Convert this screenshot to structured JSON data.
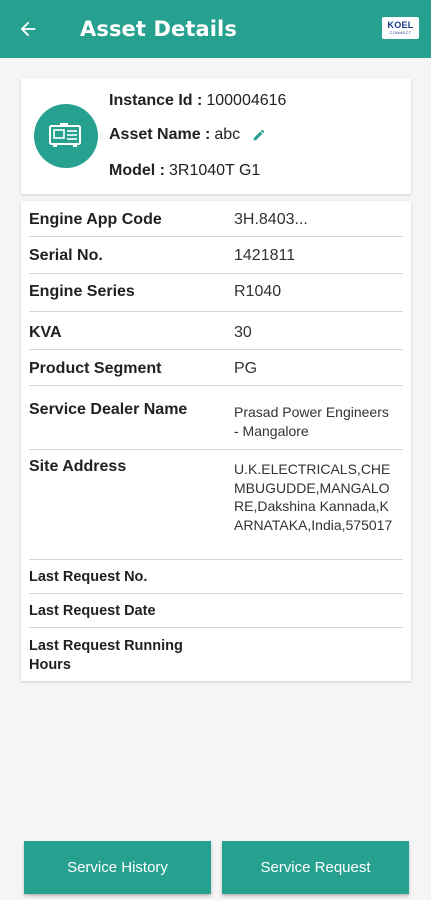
{
  "appbar": {
    "title": "Asset Details",
    "logo_line1": "KOEL",
    "logo_line2": "CONNECT",
    "color": "#27a18f"
  },
  "asset": {
    "instance_label": "Instance Id :",
    "instance_value": "100004616",
    "name_label": "Asset Name :",
    "name_value": "abc",
    "model_label": "Model  :",
    "model_value": "3R1040T G1",
    "icon": "generator-icon"
  },
  "details": [
    {
      "key": "Engine App Code",
      "value": "3H.8403..."
    },
    {
      "key": "Serial No.",
      "value": "1421811"
    },
    {
      "key": "Engine Series",
      "value": "R1040"
    },
    {
      "key": "KVA",
      "value": "30"
    },
    {
      "key": "Product Segment",
      "value": "PG"
    },
    {
      "key": "Service Dealer Name",
      "value": "Prasad Power Engineers - Mangalore"
    },
    {
      "key": "Site Address",
      "value": "U.K.ELECTRICALS,CHEMBUGUDDE,MANGALORE,Dakshina Kannada,KARNATAKA,India,575017"
    },
    {
      "key": "Last Request No.",
      "value": ""
    },
    {
      "key": "Last Request Date",
      "value": ""
    },
    {
      "key": "Last Request Running Hours",
      "value": ""
    }
  ],
  "buttons": {
    "history": "Service History",
    "request": "Service Request"
  }
}
